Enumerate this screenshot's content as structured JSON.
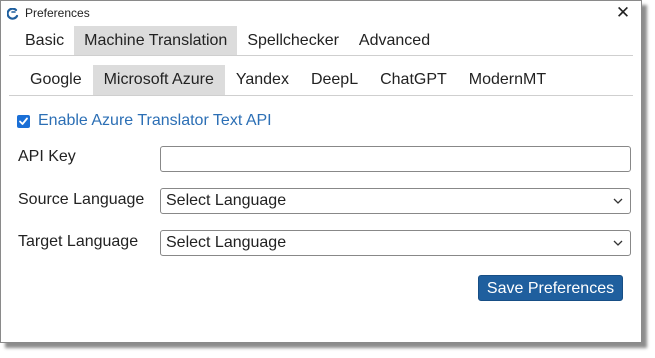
{
  "window": {
    "title": "Preferences"
  },
  "tabs_primary": [
    {
      "label": "Basic",
      "active": false
    },
    {
      "label": "Machine Translation",
      "active": true
    },
    {
      "label": "Spellchecker",
      "active": false
    },
    {
      "label": "Advanced",
      "active": false
    }
  ],
  "tabs_secondary": [
    {
      "label": "Google",
      "active": false
    },
    {
      "label": "Microsoft Azure",
      "active": true
    },
    {
      "label": "Yandex",
      "active": false
    },
    {
      "label": "DeepL",
      "active": false
    },
    {
      "label": "ChatGPT",
      "active": false
    },
    {
      "label": "ModernMT",
      "active": false
    }
  ],
  "form": {
    "enable_label": "Enable Azure Translator Text API",
    "enable_checked": true,
    "api_key_label": "API Key",
    "api_key_value": "",
    "source_label": "Source Language",
    "source_value": "Select Language",
    "target_label": "Target Language",
    "target_value": "Select Language",
    "save_label": "Save Preferences"
  },
  "colors": {
    "accent": "#1f5f9e",
    "checkbox": "#1a6fd6",
    "link_text": "#2c6fb5",
    "active_tab": "#dcdcdc"
  },
  "icons": [
    "app-logo-icon",
    "close-icon",
    "checkmark-icon",
    "chevron-down-icon"
  ]
}
